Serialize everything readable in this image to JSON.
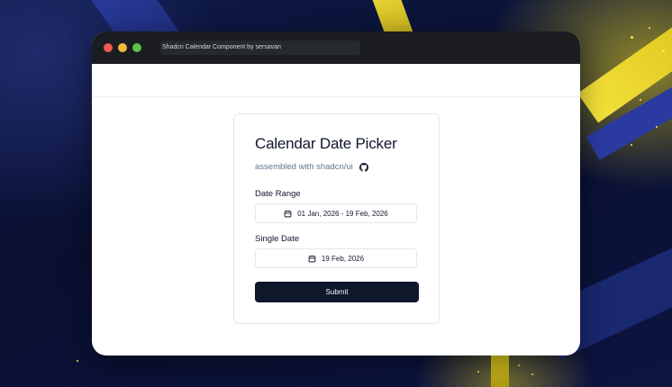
{
  "window": {
    "title": "Shadcn Calendar Component by sersavan"
  },
  "card": {
    "title": "Calendar Date Picker",
    "subtitle": "assembled with shadcn/ui",
    "github_icon": "github-icon"
  },
  "form": {
    "date_range_label": "Date Range",
    "date_range_value": "01 Jan, 2026 - 19 Feb, 2026",
    "single_date_label": "Single Date",
    "single_date_value": "19 Feb, 2026",
    "submit_label": "Submit",
    "calendar_icon": "calendar-icon"
  },
  "colors": {
    "accent": "#0f172a",
    "background": "#0b1230",
    "glow": "#ffe84a"
  }
}
